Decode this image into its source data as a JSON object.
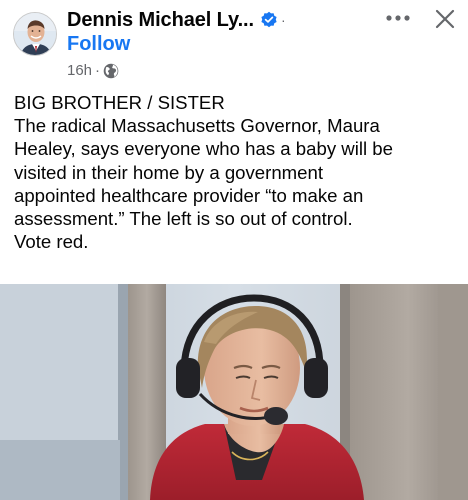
{
  "post": {
    "author": {
      "name": "Dennis Michael Ly...",
      "avatar_icon": "profile-photo",
      "verified_icon": "verified-badge-icon",
      "verified_color": "#1877f2"
    },
    "name_suffix": "·",
    "follow_label": "Follow",
    "timestamp": "16h",
    "meta_separator": "·",
    "audience_icon": "globe-icon",
    "more_icon": "more-options-icon",
    "close_icon": "close-icon",
    "text_lines": [
      "BIG BROTHER / SISTER",
      "The radical Massachusetts Governor, Maura",
      "Healey, says everyone who has a baby will be",
      "visited in their home by a government",
      "appointed healthcare provider “to make an",
      "assessment.”   The left is so out of control.",
      "Vote red."
    ],
    "media": {
      "type": "photo",
      "colors": {
        "jacket": "#b52432",
        "background_wall": "#c9d3dd",
        "pillar": "#a39c95"
      }
    }
  },
  "colors": {
    "text_primary": "#050505",
    "text_secondary": "#65676b",
    "link": "#1877f2",
    "background": "#ffffff"
  }
}
